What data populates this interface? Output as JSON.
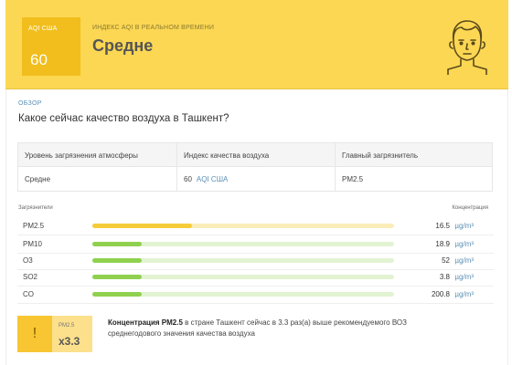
{
  "header": {
    "aqi_label": "AQI США",
    "aqi_value": "60",
    "subtitle": "ИНДЕКС AQI В РЕАЛЬНОМ ВРЕМЕНИ",
    "status": "Средне",
    "face_icon": "neutral-face-icon"
  },
  "overview": {
    "section_label": "ОБЗОР",
    "question": "Какое сейчас качество воздуха в Ташкент?",
    "table": {
      "headers": [
        "Уровень загрязнения атмосферы",
        "Индекс качества воздуха",
        "Главный загрязнитель"
      ],
      "level": "Средне",
      "aqi_value": "60",
      "aqi_unit": "AQI США",
      "main_pollutant": "PM2.5"
    }
  },
  "pollutants": {
    "header_left": "Загрязнители",
    "header_right": "Концентрация",
    "unit": "µg/m³",
    "items": [
      {
        "name": "PM2.5",
        "value": "16.5",
        "fraction": 0.33,
        "color": "#f5cc3a",
        "track": "#faedb8"
      },
      {
        "name": "PM10",
        "value": "18.9",
        "fraction": 0.165,
        "color": "#8fd14f",
        "track": "#e2f3d2"
      },
      {
        "name": "O3",
        "value": "52",
        "fraction": 0.165,
        "color": "#8fd14f",
        "track": "#e2f3d2"
      },
      {
        "name": "SO2",
        "value": "3.8",
        "fraction": 0.165,
        "color": "#8fd14f",
        "track": "#e2f3d2"
      },
      {
        "name": "CO",
        "value": "200.8",
        "fraction": 0.165,
        "color": "#8fd14f",
        "track": "#e2f3d2"
      }
    ]
  },
  "warning": {
    "icon": "!",
    "pollutant": "PM2.5",
    "multiplier": "x3.3",
    "bold_text": "Концентрация PM2.5",
    "text": " в стране Ташкент сейчас в 3.3 раз(а) выше рекомендуемого ВОЗ среднегодового значения качества воздуха"
  },
  "colors": {
    "header_bg": "#fcd753",
    "aqi_box": "#f1be1d",
    "accent_blue": "#5a8fb5"
  }
}
